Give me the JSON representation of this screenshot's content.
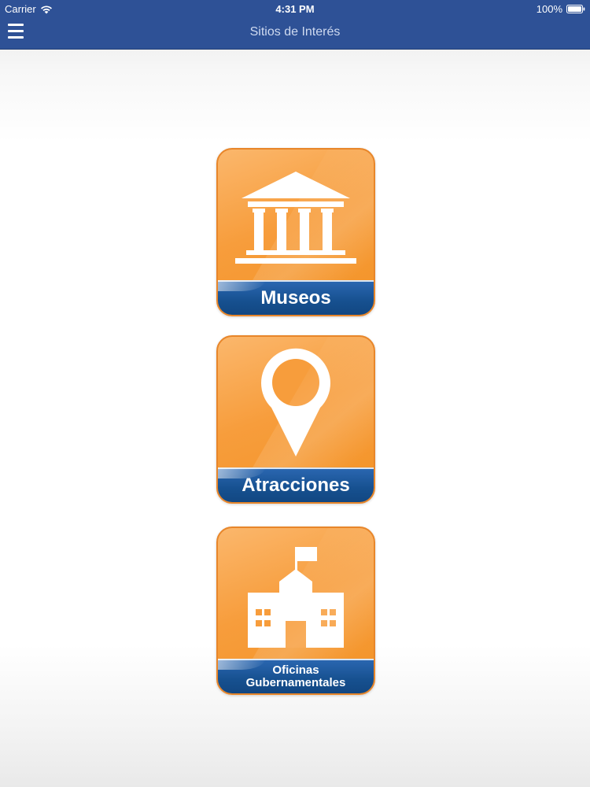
{
  "status_bar": {
    "carrier": "Carrier",
    "time": "4:31 PM",
    "battery": "100%",
    "wifi_icon": "wifi-icon",
    "battery_icon": "battery-icon"
  },
  "nav_bar": {
    "title": "Sitios de Interés",
    "menu_icon": "hamburger-menu-icon",
    "background_color": "#2e5196"
  },
  "tiles": [
    {
      "label": "Museos",
      "icon": "museum-icon"
    },
    {
      "label": "Atracciones",
      "icon": "map-pin-icon"
    },
    {
      "label_line1": "Oficinas",
      "label_line2": "Gubernamentales",
      "icon": "government-building-icon"
    }
  ],
  "colors": {
    "tile_orange": "#f79d3c",
    "tile_blue": "#16508f",
    "nav_blue": "#2e5196"
  }
}
